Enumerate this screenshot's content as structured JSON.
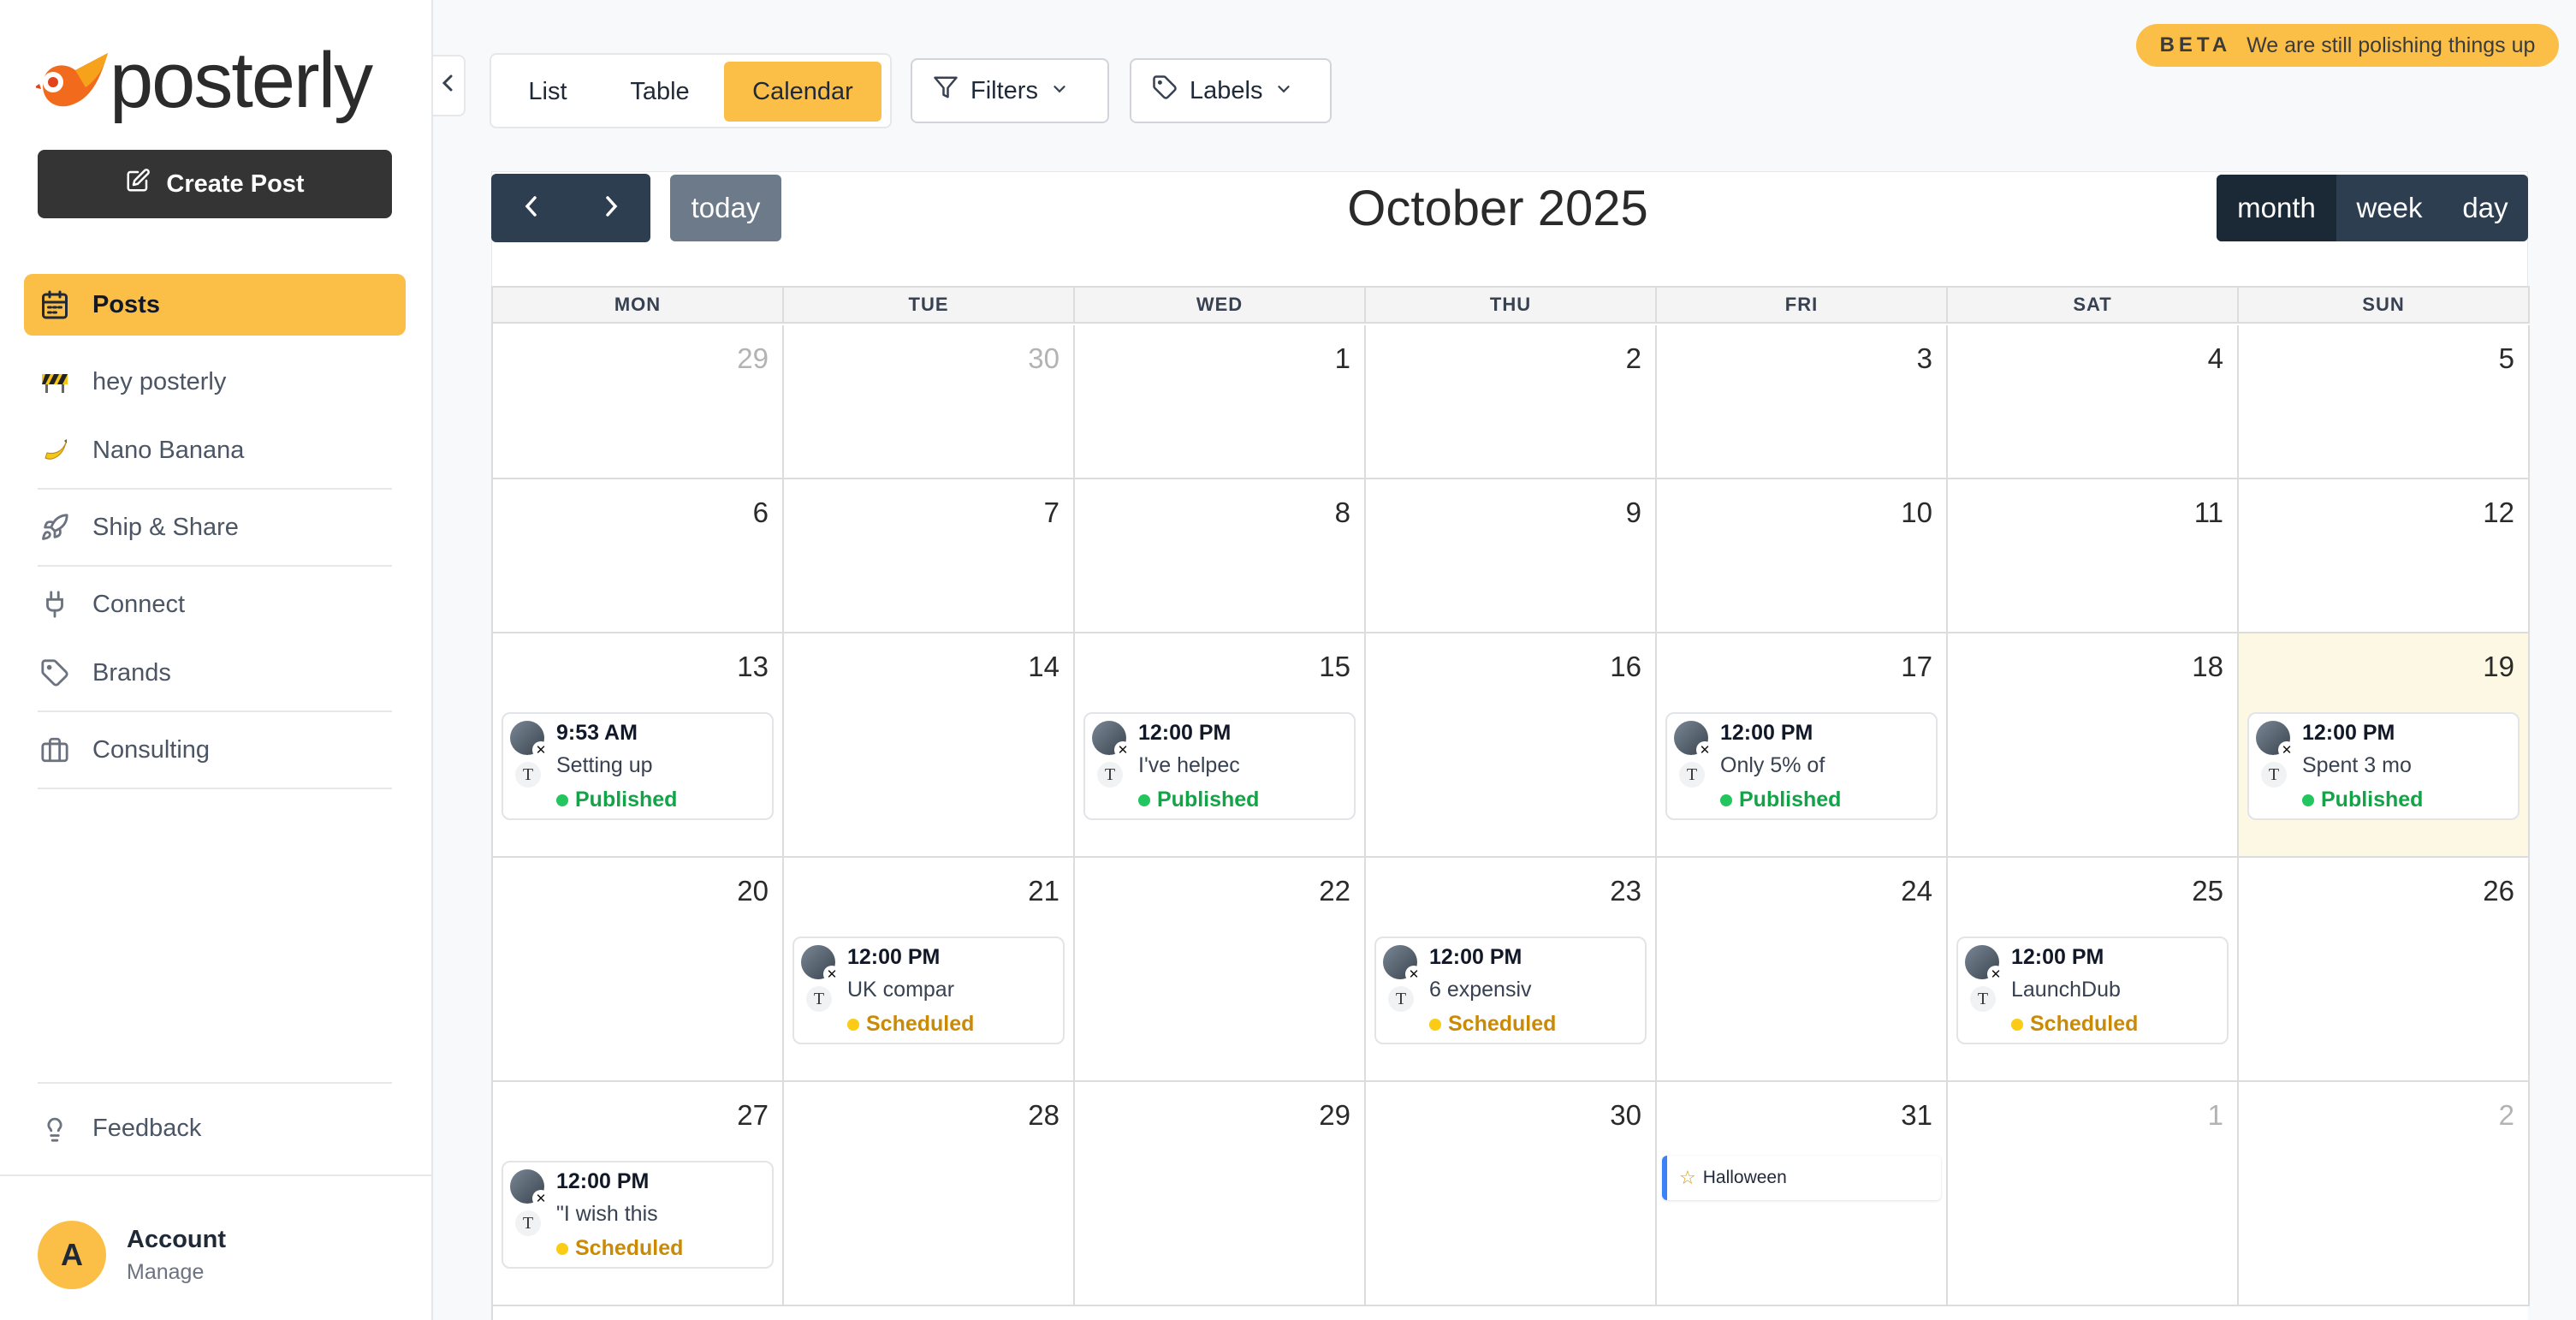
{
  "app": {
    "logo_text": "posterly",
    "create_post": "Create Post",
    "beta_tag": "BETA",
    "beta_message": "We are still polishing things up",
    "accent": "#fbbf47"
  },
  "sidebar": {
    "items": [
      {
        "label": "Posts",
        "icon": "calendar-icon",
        "active": true
      },
      {
        "label": "hey posterly",
        "icon": "construction-icon"
      },
      {
        "label": "Nano Banana",
        "icon": "banana-icon"
      },
      {
        "label": "Ship & Share",
        "icon": "rocket-icon"
      },
      {
        "label": "Connect",
        "icon": "plug-icon"
      },
      {
        "label": "Brands",
        "icon": "tag-icon"
      },
      {
        "label": "Consulting",
        "icon": "briefcase-icon"
      }
    ],
    "feedback": "Feedback",
    "account": {
      "initial": "A",
      "name": "Account",
      "sub": "Manage"
    }
  },
  "toolbar": {
    "views": [
      "List",
      "Table",
      "Calendar"
    ],
    "active_view": "Calendar",
    "filters": "Filters",
    "labels": "Labels"
  },
  "calendar": {
    "title": "October 2025",
    "today_label": "today",
    "view_modes": [
      "month",
      "week",
      "day"
    ],
    "active_mode": "month",
    "weekdays": [
      "MON",
      "TUE",
      "WED",
      "THU",
      "FRI",
      "SAT",
      "SUN"
    ],
    "weeks": [
      [
        {
          "d": "29",
          "other": true
        },
        {
          "d": "30",
          "other": true
        },
        {
          "d": "1"
        },
        {
          "d": "2"
        },
        {
          "d": "3"
        },
        {
          "d": "4"
        },
        {
          "d": "5"
        }
      ],
      [
        {
          "d": "6"
        },
        {
          "d": "7"
        },
        {
          "d": "8"
        },
        {
          "d": "9"
        },
        {
          "d": "10"
        },
        {
          "d": "11"
        },
        {
          "d": "12"
        }
      ],
      [
        {
          "d": "13"
        },
        {
          "d": "14"
        },
        {
          "d": "15"
        },
        {
          "d": "16"
        },
        {
          "d": "17"
        },
        {
          "d": "18"
        },
        {
          "d": "19",
          "today": true
        }
      ],
      [
        {
          "d": "20"
        },
        {
          "d": "21"
        },
        {
          "d": "22"
        },
        {
          "d": "23"
        },
        {
          "d": "24"
        },
        {
          "d": "25"
        },
        {
          "d": "26"
        }
      ],
      [
        {
          "d": "27"
        },
        {
          "d": "28"
        },
        {
          "d": "29"
        },
        {
          "d": "30"
        },
        {
          "d": "31"
        },
        {
          "d": "1",
          "other": true
        },
        {
          "d": "2",
          "other": true
        }
      ]
    ],
    "posts": [
      {
        "week": 2,
        "day": 0,
        "time": "9:53 AM",
        "text": "Setting up",
        "status": "Published"
      },
      {
        "week": 2,
        "day": 2,
        "time": "12:00 PM",
        "text": "I've helpec",
        "status": "Published"
      },
      {
        "week": 2,
        "day": 4,
        "time": "12:00 PM",
        "text": "Only 5% of",
        "status": "Published"
      },
      {
        "week": 2,
        "day": 6,
        "time": "12:00 PM",
        "text": "Spent 3 mo",
        "status": "Published"
      },
      {
        "week": 3,
        "day": 1,
        "time": "12:00 PM",
        "text": "UK compar",
        "status": "Scheduled"
      },
      {
        "week": 3,
        "day": 3,
        "time": "12:00 PM",
        "text": "6 expensiv",
        "status": "Scheduled"
      },
      {
        "week": 3,
        "day": 5,
        "time": "12:00 PM",
        "text": "LaunchDub",
        "status": "Scheduled"
      },
      {
        "week": 4,
        "day": 0,
        "time": "12:00 PM",
        "text": "\"I wish this",
        "status": "Scheduled"
      }
    ],
    "events": [
      {
        "week": 4,
        "day": 4,
        "title": "Halloween"
      }
    ]
  }
}
